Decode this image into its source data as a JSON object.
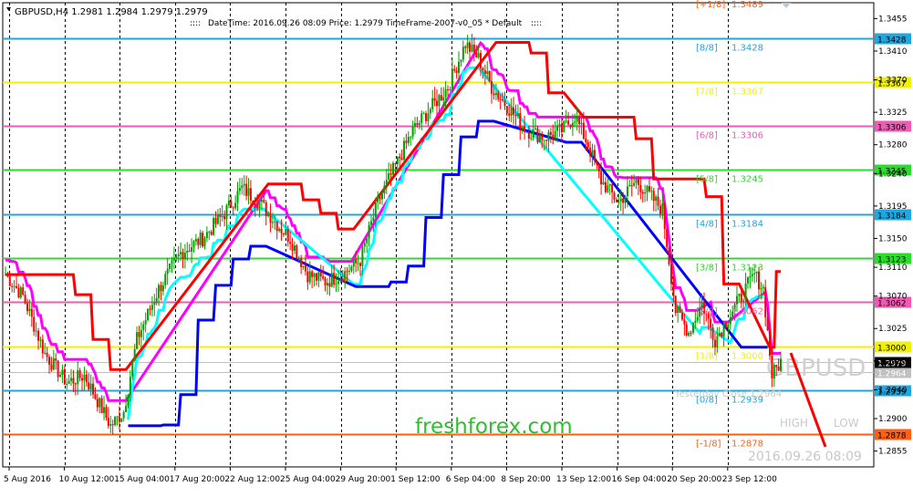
{
  "header": {
    "symbol_info": "GBPUSD,H4  1.2981 1.2984 1.2979 1.2979",
    "indicator_info": "DateTime: 2016.09.26 08:09   Price: 1.2979   TimeFrame-2007-v0_05    *   Default"
  },
  "watermark": {
    "symbol": "GBPUSD",
    "datetime": "2016.09.26 08:09",
    "high_label": "HIGH",
    "low_label": "LOW",
    "brand": "freshforex.com"
  },
  "yesterday_close": "Yesterday Close 1.2964",
  "colors": {
    "bull": "#00a000",
    "bear": "#ff0000",
    "magenta": "#ff00ff",
    "cyan": "#00ffff",
    "blue": "#0000ff",
    "red_line": "#ff0000"
  },
  "chart_data": {
    "type": "candlestick",
    "symbol": "GBPUSD",
    "timeframe": "H4",
    "ylim": [
      1.2833,
      1.3477
    ],
    "y_ticks": [
      "1.3455",
      "1.3410",
      "1.3370",
      "1.3325",
      "1.3280",
      "1.3240",
      "1.3195",
      "1.3150",
      "1.3110",
      "1.3070",
      "1.3025",
      "1.2980",
      "1.2940",
      "1.2900",
      "1.2855"
    ],
    "x_ticks": [
      "5 Aug 2016",
      "10 Aug 12:00",
      "15 Aug 04:00",
      "17 Aug 20:00",
      "22 Aug 12:00",
      "25 Aug 04:00",
      "29 Aug 20:00",
      "1 Sep 12:00",
      "6 Sep 04:00",
      "8 Sep 20:00",
      "13 Sep 12:00",
      "16 Sep 04:00",
      "20 Sep 20:00",
      "23 Sep 12:00"
    ],
    "close_anchors": [
      [
        0,
        1.31
      ],
      [
        8,
        1.307
      ],
      [
        18,
        1.299
      ],
      [
        28,
        1.295
      ],
      [
        36,
        1.296
      ],
      [
        42,
        1.2925
      ],
      [
        48,
        1.289
      ],
      [
        54,
        1.291
      ],
      [
        60,
        1.301
      ],
      [
        70,
        1.308
      ],
      [
        80,
        1.313
      ],
      [
        90,
        1.315
      ],
      [
        100,
        1.3185
      ],
      [
        108,
        1.322
      ],
      [
        116,
        1.32
      ],
      [
        124,
        1.317
      ],
      [
        130,
        1.315
      ],
      [
        138,
        1.31
      ],
      [
        146,
        1.309
      ],
      [
        154,
        1.31
      ],
      [
        162,
        1.312
      ],
      [
        170,
        1.32
      ],
      [
        178,
        1.325
      ],
      [
        186,
        1.33
      ],
      [
        194,
        1.333
      ],
      [
        202,
        1.336
      ],
      [
        210,
        1.342
      ],
      [
        216,
        1.34
      ],
      [
        222,
        1.336
      ],
      [
        230,
        1.333
      ],
      [
        238,
        1.33
      ],
      [
        246,
        1.329
      ],
      [
        254,
        1.33
      ],
      [
        260,
        1.332
      ],
      [
        266,
        1.328
      ],
      [
        272,
        1.323
      ],
      [
        280,
        1.32
      ],
      [
        288,
        1.323
      ],
      [
        294,
        1.321
      ],
      [
        300,
        1.319
      ],
      [
        306,
        1.305
      ],
      [
        312,
        1.302
      ],
      [
        318,
        1.306
      ],
      [
        324,
        1.301
      ],
      [
        330,
        1.304
      ],
      [
        336,
        1.307
      ],
      [
        342,
        1.31
      ],
      [
        346,
        1.308
      ],
      [
        350,
        1.296
      ],
      [
        354,
        1.2979
      ]
    ],
    "murrey_levels": [
      {
        "name": "[8/8]",
        "price": 1.3428,
        "color": "#1ea7e1"
      },
      {
        "name": "[7/8]",
        "price": 1.3367,
        "color": "#f2f200"
      },
      {
        "name": "[6/8]",
        "price": 1.3306,
        "color": "#f05ab4"
      },
      {
        "name": "[5/8]",
        "price": 1.3245,
        "color": "#2cdc2c"
      },
      {
        "name": "[4/8]",
        "price": 1.3184,
        "color": "#1ea7e1"
      },
      {
        "name": "[3/8]",
        "price": 1.3123,
        "color": "#2cdc2c"
      },
      {
        "name": "[2/8]",
        "price": 1.3062,
        "color": "#f05ab4"
      },
      {
        "name": "[1/8]",
        "price": 1.3,
        "color": "#f2f200"
      },
      {
        "name": "[0/8]",
        "price": 1.2939,
        "color": "#1ea7e1"
      },
      {
        "name": "[-1/8]",
        "price": 1.2878,
        "color": "#ff6010"
      }
    ],
    "extra_levels": [
      {
        "name": "[+1/8]",
        "price": 1.3489
      }
    ],
    "yesterday_close_price": 1.2964,
    "bid": 1.2979
  }
}
